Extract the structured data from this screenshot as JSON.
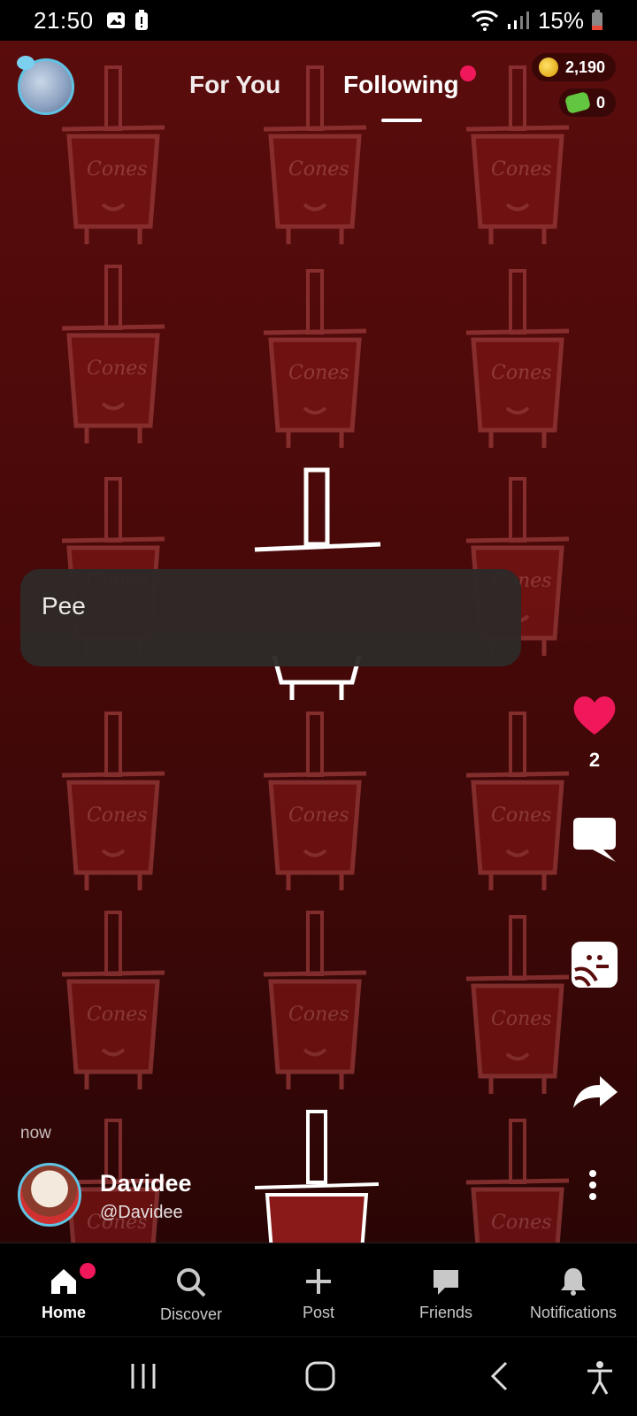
{
  "status_bar": {
    "time": "21:50",
    "battery": "15%",
    "icons": [
      "image-icon",
      "battery-saver-icon",
      "wifi-icon",
      "signal-icon",
      "battery-icon"
    ]
  },
  "top_nav": {
    "tabs": [
      {
        "label": "For You",
        "active": false
      },
      {
        "label": "Following",
        "active": true,
        "has_notification_dot": true
      }
    ],
    "coins": "2,190",
    "cash": "0"
  },
  "post": {
    "caption": "Pee",
    "likes": "2",
    "timestamp": "now",
    "author_name": "Davidee",
    "author_handle": "@Davidee"
  },
  "bottom_nav": {
    "items": [
      {
        "label": "Home",
        "icon": "home-icon",
        "active": true,
        "has_notification_dot": true
      },
      {
        "label": "Discover",
        "icon": "search-icon",
        "active": false
      },
      {
        "label": "Post",
        "icon": "plus-icon",
        "active": false
      },
      {
        "label": "Friends",
        "icon": "chat-icon",
        "active": false
      },
      {
        "label": "Notifications",
        "icon": "bell-icon",
        "active": false
      }
    ]
  },
  "colors": {
    "accent": "#f0185a",
    "background": "#4a0909",
    "caption_bg": "#2e2a28"
  }
}
